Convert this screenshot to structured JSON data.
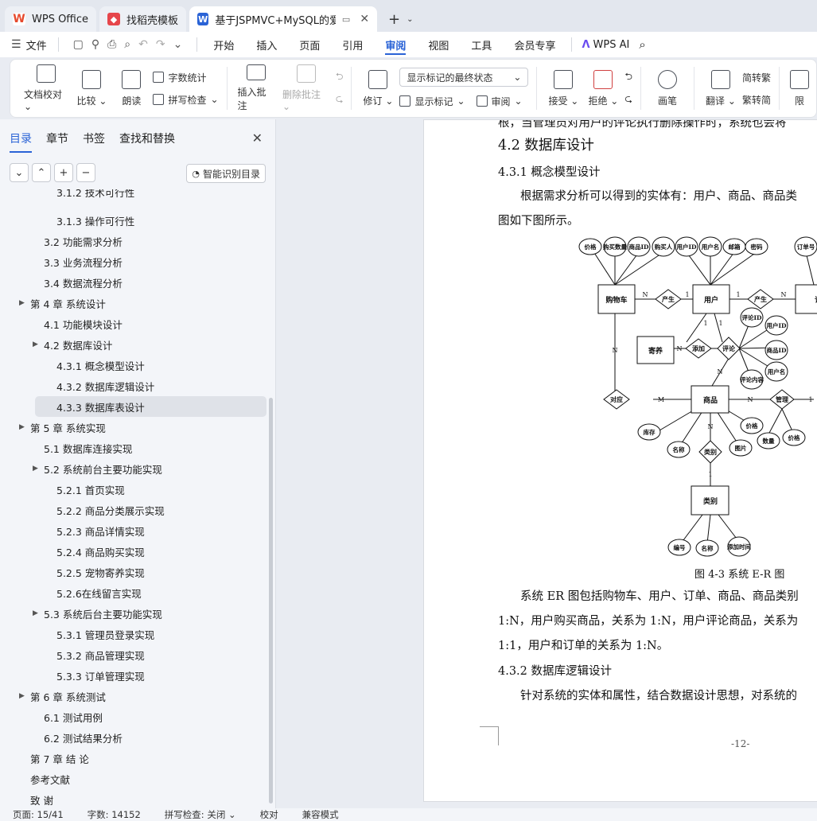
{
  "tabs": [
    {
      "label": "WPS Office",
      "icon": "wps-logo-icon",
      "color": "#e64a2e"
    },
    {
      "label": "找稻壳模板",
      "icon": "docer-logo-icon",
      "color": "#e6464b"
    },
    {
      "label": "基于JSPMVC+MySQL的爱宠",
      "icon": "word-doc-icon",
      "color": "#2a63d6"
    }
  ],
  "menu": {
    "file": "文件",
    "items": [
      "开始",
      "插入",
      "页面",
      "引用",
      "审阅",
      "视图",
      "工具",
      "会员专享"
    ],
    "active": "审阅",
    "wps_ai": "WPS AI"
  },
  "ribbon": {
    "doc_check": "文档校对",
    "compare": "比较",
    "read_aloud": "朗读",
    "word_count": "字数统计",
    "spell_check": "拼写检查",
    "insert_comment": "插入批注",
    "delete_comment": "删除批注",
    "revise": "修订",
    "markup_state": "显示标记的最终状态",
    "show_markup": "显示标记",
    "review": "审阅",
    "accept": "接受",
    "reject": "拒绝",
    "pen": "画笔",
    "translate": "翻译",
    "to_traditional": "简转繁",
    "to_simplified": "繁转简",
    "restrict": "限"
  },
  "sidebar": {
    "tabs": [
      "目录",
      "章节",
      "书签",
      "查找和替换"
    ],
    "smart_toc": "智能识别目录",
    "toc": [
      {
        "label": "3.1.2 技术可行性",
        "level": 3,
        "partial": true
      },
      {
        "label": "3.1.3 操作可行性",
        "level": 3
      },
      {
        "label": "3.2  功能需求分析",
        "level": 2
      },
      {
        "label": "3.3  业务流程分析",
        "level": 2
      },
      {
        "label": "3.4  数据流程分析",
        "level": 2
      },
      {
        "label": "第 4 章  系统设计",
        "level": 1,
        "arrow": true
      },
      {
        "label": "4.1  功能模块设计",
        "level": 2
      },
      {
        "label": "4.2  数据库设计",
        "level": 2,
        "arrow": true
      },
      {
        "label": "4.3.1  概念模型设计",
        "level": 3
      },
      {
        "label": "4.3.2  数据库逻辑设计",
        "level": 3
      },
      {
        "label": "4.3.3  数据库表设计",
        "level": 3,
        "selected": true
      },
      {
        "label": "第 5 章  系统实现",
        "level": 1,
        "arrow": true
      },
      {
        "label": "5.1  数据库连接实现",
        "level": 2
      },
      {
        "label": "5.2  系统前台主要功能实现",
        "level": 2,
        "arrow": true
      },
      {
        "label": "5.2.1  首页实现",
        "level": 3
      },
      {
        "label": "5.2.2  商品分类展示实现",
        "level": 3
      },
      {
        "label": "5.2.3  商品详情实现",
        "level": 3
      },
      {
        "label": "5.2.4  商品购买实现",
        "level": 3
      },
      {
        "label": "5.2.5  宠物寄养实现",
        "level": 3
      },
      {
        "label": "5.2.6在线留言实现",
        "level": 3
      },
      {
        "label": "5.3  系统后台主要功能实现",
        "level": 2,
        "arrow": true
      },
      {
        "label": "5.3.1  管理员登录实现",
        "level": 3
      },
      {
        "label": "5.3.2  商品管理实现",
        "level": 3
      },
      {
        "label": "5.3.3  订单管理实现",
        "level": 3
      },
      {
        "label": "第 6 章  系统测试",
        "level": 1,
        "arrow": true
      },
      {
        "label": "6.1  测试用例",
        "level": 2
      },
      {
        "label": "6.2  测试结果分析",
        "level": 2
      },
      {
        "label": "第 7 章  结    论",
        "level": 1
      },
      {
        "label": "参考文献",
        "level": 1
      },
      {
        "label": "致  谢",
        "level": 1
      }
    ]
  },
  "document": {
    "top_partial": "根，当管理员对用户的评论执行删除操作时，系统也会将",
    "heading_42": "4.2  数据库设计",
    "heading_431": "4.3.1  概念模型设计",
    "para1_line1": "根据需求分析可以得到的实体有：用户、商品、商品类",
    "para1_line2": "图如下图所示。",
    "figure_caption": "图 4-3 系统 E-R 图",
    "para2_line1": "系统 ER 图包括购物车、用户、订单、商品、商品类别",
    "para2_line2": "1:N，用户购买商品，关系为 1:N，用户评论商品，关系为",
    "para2_line3": "1:1，用户和订单的关系为 1:N。",
    "heading_432": "4.3.2  数据库逻辑设计",
    "para3_line1": "针对系统的实体和属性，结合数据设计思想，对系统的",
    "page_number": "-12-"
  },
  "er": {
    "entities": {
      "cart": "购物车",
      "user": "用户",
      "order": "订单",
      "coupon": "寄养",
      "goods": "商品",
      "category": "类别"
    },
    "relations": {
      "produce1": "产生",
      "produce2": "产生",
      "add": "添加",
      "comment": "评论",
      "correspond": "对应",
      "manage": "管理",
      "category_rel": "类别"
    },
    "attrs": {
      "price": "价格",
      "buy_qty": "购买数量",
      "goods_id": "商品ID",
      "buyer": "购买人",
      "user_id": "用户ID",
      "user_name": "用户名",
      "email": "邮箱",
      "password": "密码",
      "order_no": "订单号",
      "name_cut": "名称",
      "comment_id": "评论ID",
      "c_user_id": "用户ID",
      "c_goods_id": "商品ID",
      "c_user_name": "用户名",
      "comment_content": "评论内容",
      "stock": "库存",
      "g_name": "名称",
      "g_price": "价格",
      "image": "图片",
      "qty": "数量",
      "m_price": "价格",
      "cat_no": "编号",
      "cat_name": "名称",
      "add_time": "添加时间"
    },
    "cards": {
      "N": "N",
      "M": "M",
      "one": "1"
    }
  },
  "status": {
    "page": "页面: 15/41",
    "words": "字数: 14152",
    "spell": "拼写检查: 关闭",
    "proof": "校对",
    "compat": "兼容模式"
  }
}
